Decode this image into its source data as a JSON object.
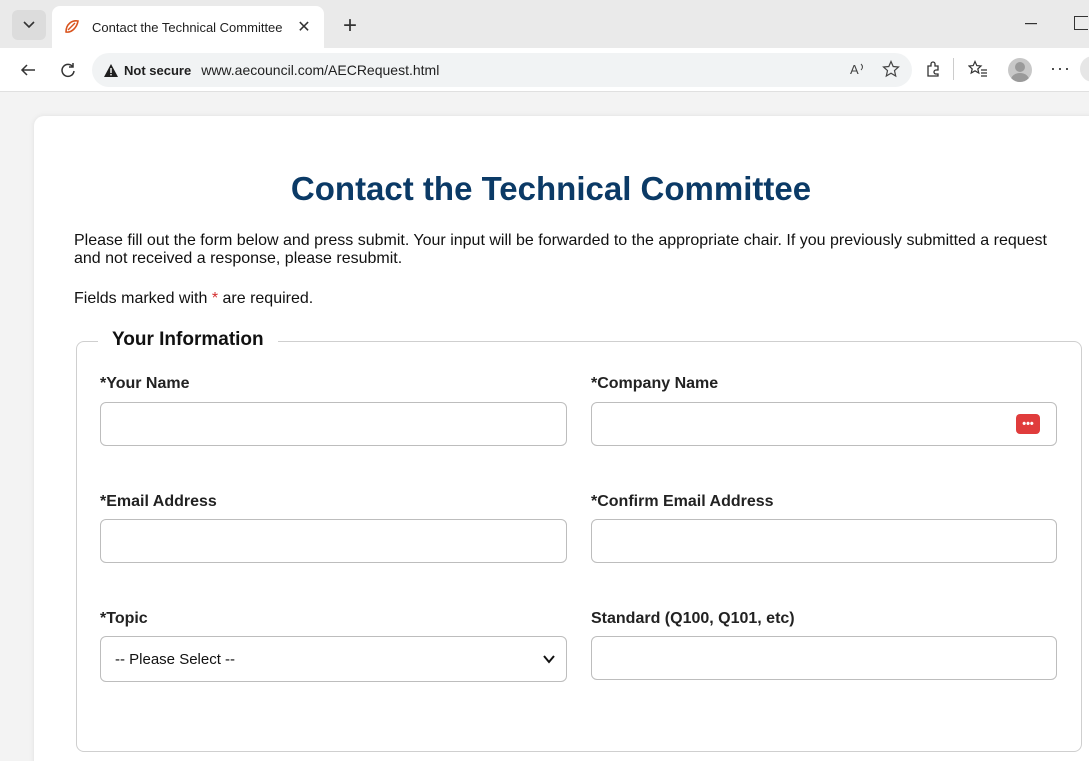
{
  "browser": {
    "tab_title": "Contact the Technical Committee",
    "tab_close": "✕",
    "new_tab": "+",
    "security_label": "Not secure",
    "url": "www.aecouncil.com/AECRequest.html",
    "more": "···"
  },
  "page": {
    "title": "Contact the Technical Committee",
    "intro": "Please fill out the form below and press submit. Your input will be forwarded to the appropriate chair. If you previously submitted a request and not received a response, please resubmit.",
    "required_note_prefix": "Fields marked with ",
    "required_star": "*",
    "required_note_suffix": " are required."
  },
  "form": {
    "legend": "Your Information",
    "fields": {
      "your_name": {
        "label": "*Your Name",
        "value": ""
      },
      "company_name": {
        "label": "*Company Name",
        "value": ""
      },
      "email": {
        "label": "*Email Address",
        "value": ""
      },
      "confirm_email": {
        "label": "*Confirm Email Address",
        "value": ""
      },
      "topic": {
        "label": "*Topic",
        "selected": "-- Please Select --"
      },
      "standard": {
        "label": "Standard (Q100, Q101, etc)",
        "value": ""
      }
    }
  }
}
